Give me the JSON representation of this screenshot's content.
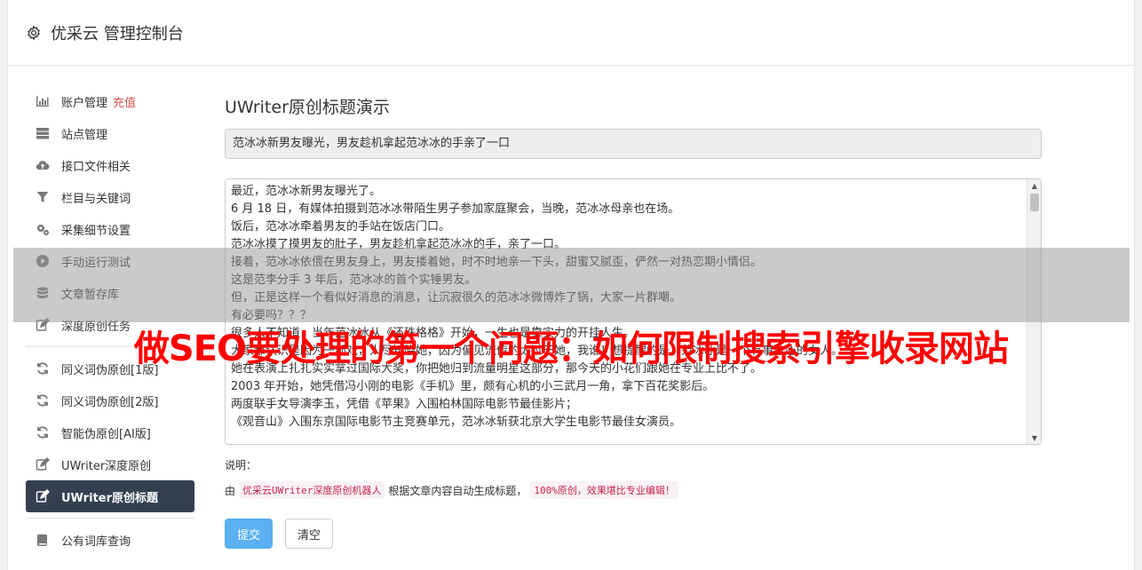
{
  "header": {
    "title": "优采云 管理控制台",
    "icon": "gear-icon"
  },
  "sidebar": {
    "items": [
      {
        "label": "账户管理",
        "highlight": "充值",
        "icon": "bar-chart-icon"
      },
      {
        "label": "站点管理",
        "icon": "server-icon"
      },
      {
        "label": "接口文件相关",
        "icon": "cloud-upload-icon"
      },
      {
        "label": "栏目与关键词",
        "icon": "filter-icon"
      },
      {
        "label": "采集细节设置",
        "icon": "cogs-icon"
      },
      {
        "label": "手动运行测试",
        "icon": "play-circle-icon"
      },
      {
        "label": "文章暂存库",
        "icon": "database-icon"
      },
      {
        "label": "深度原创任务",
        "icon": "edit-icon"
      },
      {
        "label": "同义词伪原创[1版]",
        "icon": "refresh-icon"
      },
      {
        "label": "同义词伪原创[2版]",
        "icon": "refresh-icon"
      },
      {
        "label": "智能伪原创[AI版]",
        "icon": "refresh-icon"
      },
      {
        "label": "UWriter深度原创",
        "icon": "edit-icon"
      },
      {
        "label": "UWriter原创标题",
        "icon": "edit-icon",
        "active": true
      },
      {
        "label": "公有词库查询",
        "icon": "book-icon"
      }
    ]
  },
  "main": {
    "title": "UWriter原创标题演示",
    "title_value": "范冰冰新男友曝光，男友趁机拿起范冰冰的手亲了一口",
    "body_lines": [
      "最近，范冰冰新男友曝光了。",
      "6 月 18 日，有媒体拍摄到范冰冰带陌生男子参加家庭聚会，当晚，范冰冰母亲也在场。",
      "饭后，范冰冰牵着男友的手站在饭店门口。",
      "范冰冰摸了摸男友的肚子，男友趁机拿起范冰冰的手，亲了一口。",
      "接着，范冰冰依偎在男友身上，男友搂着她，时不时地亲一下头，甜蜜又腻歪，俨然一对热恋期小情侣。",
      "这是范李分手 3 年后，范冰冰的首个实锤男友。",
      "但，正是这样一个看似好消息的消息，让沉寂很久的范冰冰微博炸了锅，大家一片群嘲。",
      "有必要吗？？？",
      "很多人不知道，当年范冰冰从《还珠格格》开始，一生也是靠实力的开挂人生。",
      "大家都认识是因为一部戏，人尽知晓她，因为偏见流传的太过于她，我谁！想提醒的是，范冰冰是一个有事业心的女人。",
      "她在表演上扎扎实实拿过国际大奖，你把她归到流量明星这部分，那今天的小花们跟她在专业上比不了。",
      "2003 年开始，她凭借冯小刚的电影《手机》里，颇有心机的小三武月一角，拿下百花奖影后。",
      "两度联手女导演李玉，凭借《苹果》入围柏林国际电影节最佳影片；",
      "《观音山》入围东京国际电影节主竞赛单元，范冰冰斩获北京大学生电影节最佳女演员。"
    ],
    "note_label": "说明：",
    "note_prefix": "由",
    "note_tag1": "优采云UWriter深度原创机器人",
    "note_middle": "根据文章内容自动生成标题，",
    "note_tag2": "100%原创，效果堪比专业编辑！",
    "submit_label": "提交",
    "clear_label": "清空"
  },
  "overlay": {
    "text": "做SEO要处理的第一个问题：如何限制搜索引擎收录网站"
  },
  "colors": {
    "active_nav_bg": "#344052",
    "primary_button": "#5ab0f0",
    "overlay_text": "#ff0000",
    "highlight": "#d9534f"
  }
}
